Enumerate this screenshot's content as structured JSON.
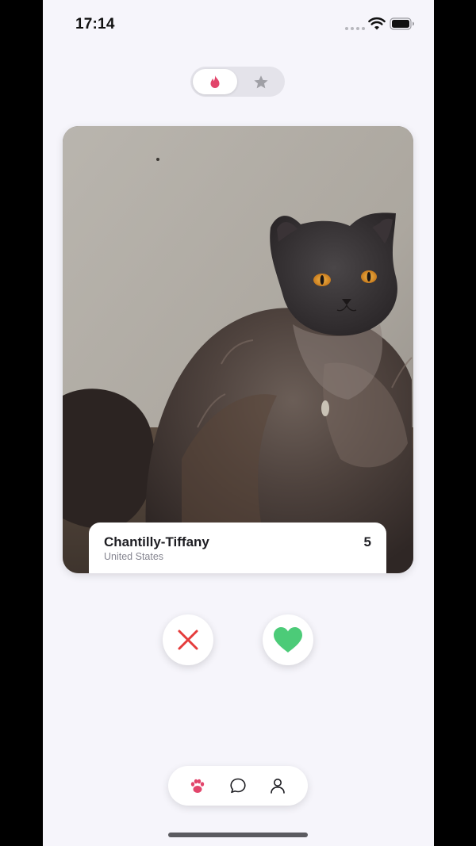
{
  "status_bar": {
    "time": "17:14"
  },
  "mode_switch": {
    "active_icon": "flame-icon",
    "inactive_icon": "star-icon"
  },
  "profile_card": {
    "name": "Chantilly-Tiffany",
    "location": "United States",
    "age": "5"
  },
  "actions": {
    "dislike_icon": "close-icon",
    "like_icon": "heart-icon"
  },
  "tab_bar": {
    "items": [
      {
        "icon": "paw-icon",
        "active": true
      },
      {
        "icon": "chat-bubble-icon",
        "active": false
      },
      {
        "icon": "person-icon",
        "active": false
      }
    ]
  },
  "colors": {
    "accent_pink": "#e2456b",
    "dislike_red": "#e53b3b",
    "like_green": "#4ccb78",
    "background": "#f6f5fb"
  }
}
